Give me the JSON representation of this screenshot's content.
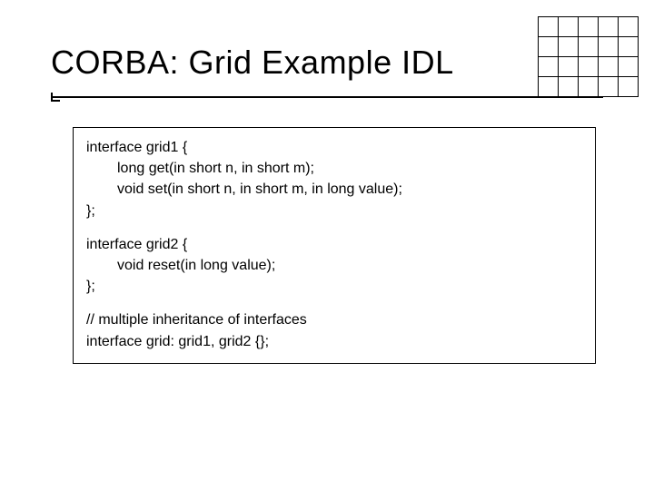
{
  "title": "CORBA: Grid Example IDL",
  "grid_icon": {
    "rows": 4,
    "cols": 5
  },
  "code": {
    "block1": {
      "l1": "interface grid1 {",
      "l2": "long get(in short n, in short m);",
      "l3": "void set(in short n, in short m, in long value);",
      "l4": "};"
    },
    "block2": {
      "l1": "interface grid2 {",
      "l2": "void reset(in long value);",
      "l3": "};"
    },
    "block3": {
      "l1": "// multiple inheritance of interfaces",
      "l2": "interface grid: grid1, grid2 {};"
    }
  }
}
